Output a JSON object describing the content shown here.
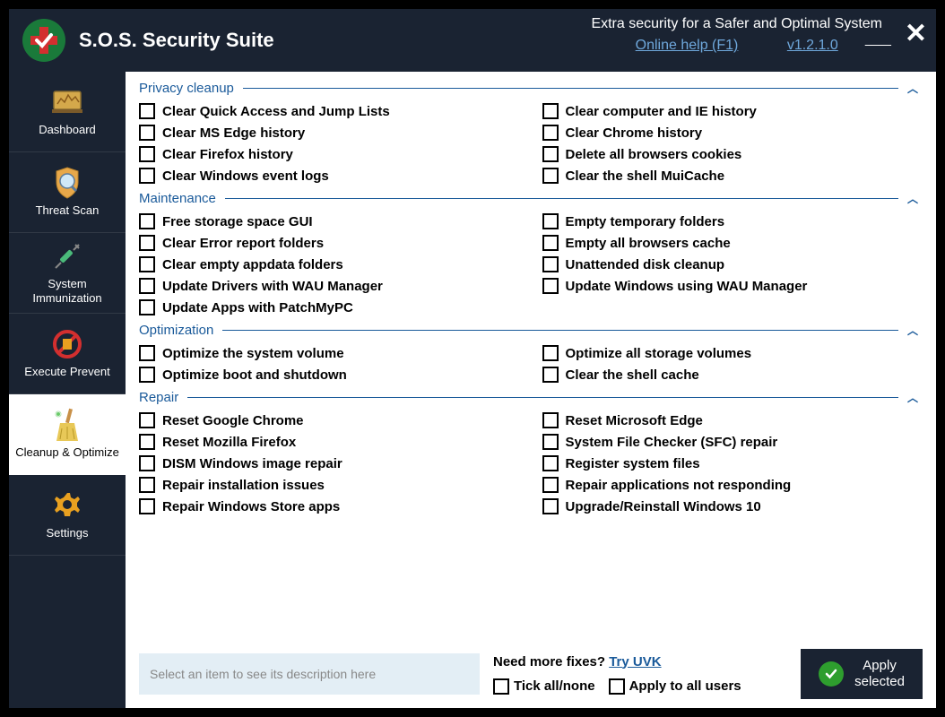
{
  "app": {
    "title": "S.O.S. Security Suite",
    "tagline": "Extra security for a Safer and Optimal System",
    "help_link": "Online help (F1)",
    "version": "v1.2.1.0"
  },
  "sidebar": {
    "items": [
      {
        "label": "Dashboard",
        "icon": "dashboard"
      },
      {
        "label": "Threat Scan",
        "icon": "shield"
      },
      {
        "label": "System Immunization",
        "icon": "syringe"
      },
      {
        "label": "Execute Prevent",
        "icon": "block"
      },
      {
        "label": "Cleanup & Optimize",
        "icon": "broom"
      },
      {
        "label": "Settings",
        "icon": "gear"
      }
    ],
    "active_index": 4
  },
  "sections": [
    {
      "title": "Privacy cleanup",
      "options_left": [
        "Clear Quick Access and Jump Lists",
        "Clear MS Edge history",
        "Clear Firefox history",
        "Clear Windows event logs"
      ],
      "options_right": [
        "Clear computer and IE history",
        "Clear Chrome history",
        "Delete all browsers cookies",
        "Clear the shell MuiCache"
      ]
    },
    {
      "title": "Maintenance",
      "options_left": [
        "Free storage space GUI",
        "Clear Error report folders",
        "Clear empty appdata folders",
        "Update Drivers with WAU Manager",
        "Update Apps with PatchMyPC"
      ],
      "options_right": [
        "Empty temporary folders",
        "Empty all browsers cache",
        "Unattended disk cleanup",
        "Update Windows using WAU Manager"
      ]
    },
    {
      "title": "Optimization",
      "options_left": [
        "Optimize the system volume",
        "Optimize boot and shutdown"
      ],
      "options_right": [
        "Optimize all storage volumes",
        "Clear the shell cache"
      ]
    },
    {
      "title": "Repair",
      "options_left": [
        "Reset Google Chrome",
        "Reset Mozilla Firefox",
        "DISM Windows image repair",
        "Repair installation issues",
        "Repair Windows Store apps"
      ],
      "options_right": [
        "Reset Microsoft Edge",
        "System File Checker (SFC) repair",
        "Register system files",
        "Repair applications not responding",
        "Upgrade/Reinstall Windows 10"
      ]
    }
  ],
  "footer": {
    "description_placeholder": "Select an item to see its description here",
    "need_more_prefix": "Need more fixes? ",
    "need_more_link": "Try UVK",
    "tick_all_label": "Tick all/none",
    "apply_all_users_label": "Apply to all users",
    "apply_button": "Apply selected"
  }
}
